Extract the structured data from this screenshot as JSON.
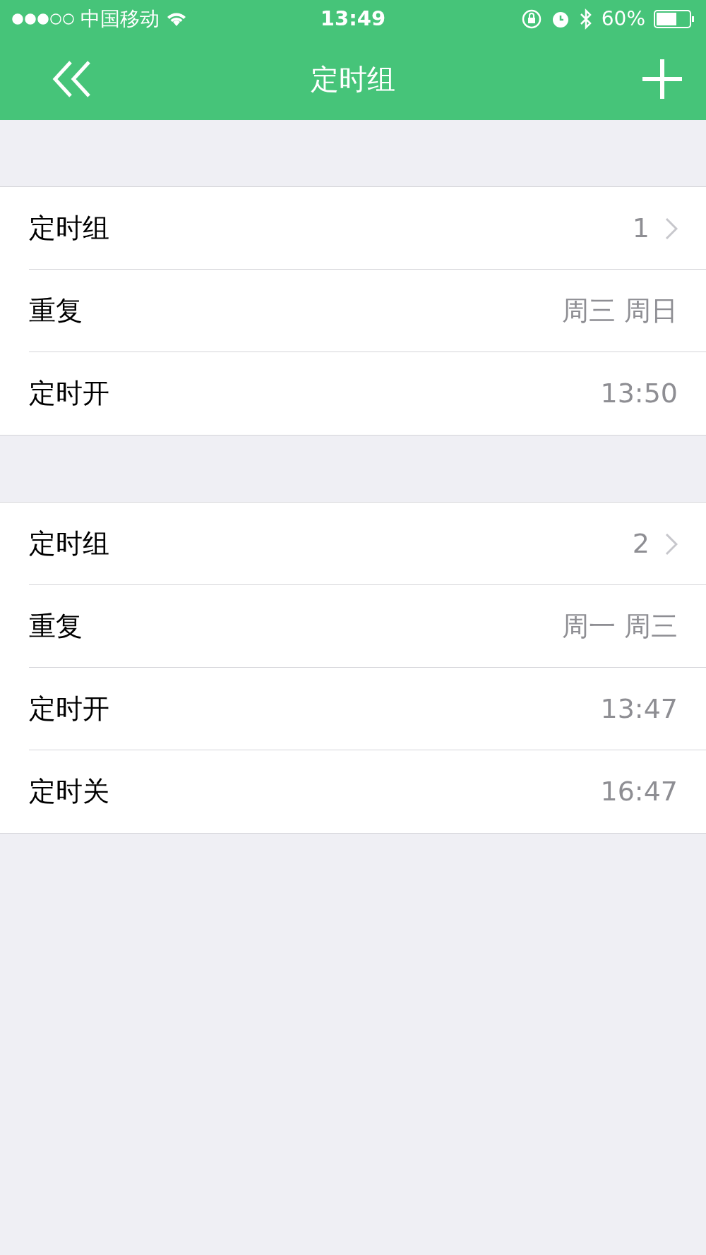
{
  "status_bar": {
    "carrier": "中国移动",
    "time": "13:49",
    "battery": "60%"
  },
  "nav": {
    "title": "定时组"
  },
  "groups": [
    {
      "rows": [
        {
          "label": "定时组",
          "value": "1",
          "disclosure": true
        },
        {
          "label": "重复",
          "value": "周三 周日",
          "disclosure": false
        },
        {
          "label": "定时开",
          "value": "13:50",
          "disclosure": false
        }
      ]
    },
    {
      "rows": [
        {
          "label": "定时组",
          "value": "2",
          "disclosure": true
        },
        {
          "label": "重复",
          "value": "周一 周三",
          "disclosure": false
        },
        {
          "label": "定时开",
          "value": "13:47",
          "disclosure": false
        },
        {
          "label": "定时关",
          "value": "16:47",
          "disclosure": false
        }
      ]
    }
  ]
}
